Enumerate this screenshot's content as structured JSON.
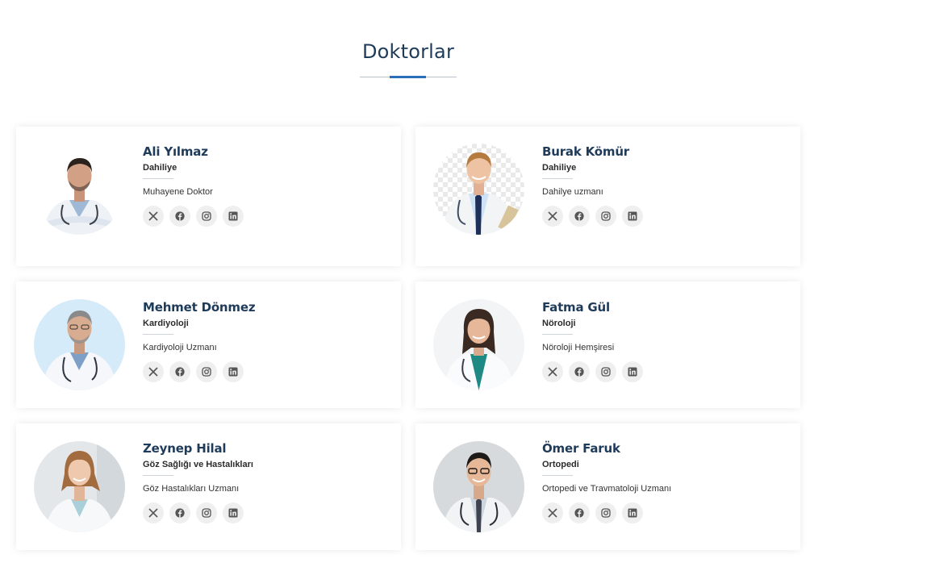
{
  "section": {
    "title": "Doktorlar"
  },
  "colors": {
    "accent": "#2a6db8",
    "heading": "#1f3b5a",
    "social_bg": "#efefef",
    "social_icon": "#555555"
  },
  "social_icons": [
    "x-icon",
    "facebook-icon",
    "instagram-icon",
    "linkedin-icon"
  ],
  "doctors": [
    {
      "name": "Ali Yılmaz",
      "department": "Dahiliye",
      "title": "Muhayene Doktor"
    },
    {
      "name": "Burak Kömür",
      "department": "Dahiliye",
      "title": "Dahilye uzmanı"
    },
    {
      "name": "Mehmet Dönmez",
      "department": "Kardiyoloji",
      "title": "Kardiyoloji Uzmanı"
    },
    {
      "name": "Fatma Gül",
      "department": "Nöroloji",
      "title": "Nöroloji Hemşiresi"
    },
    {
      "name": "Zeynep Hilal",
      "department": "Göz Sağlığı ve Hastalıkları",
      "title": "Göz Hastalıkları Uzmanı"
    },
    {
      "name": "Ömer Faruk",
      "department": "Ortopedi",
      "title": "Ortopedi ve Travmatoloji Uzmanı"
    }
  ]
}
